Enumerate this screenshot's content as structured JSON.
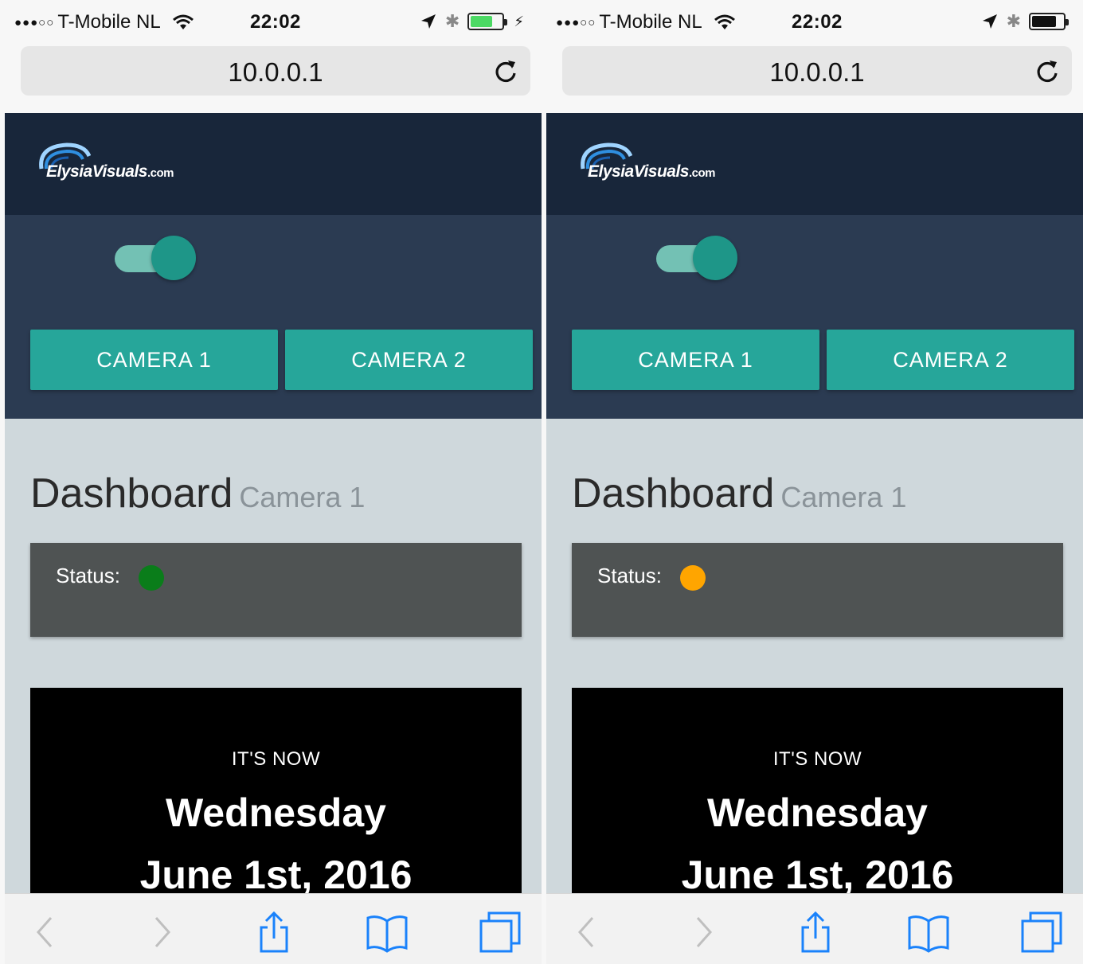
{
  "phones": [
    {
      "statusbar": {
        "signal": "●●●○○",
        "carrier": "T-Mobile NL",
        "time": "22:02",
        "bluetooth": "✱",
        "battery_fraction": 0.7,
        "battery_color": "#4cd964",
        "charging": true
      },
      "browser": {
        "url": "10.0.0.1"
      },
      "site": {
        "logo": {
          "text": "ElysiaVisuals",
          "suffix": ".com"
        },
        "toggle": {
          "state": "on"
        },
        "buttons": {
          "camera1": "CAMERA 1",
          "camera2": "CAMERA 2"
        },
        "dashboard": {
          "title": "Dashboard",
          "subtitle": "Camera 1"
        },
        "status": {
          "label": "Status:",
          "color": "#0a7d1a"
        },
        "clock": {
          "caption": "IT'S NOW",
          "day": "Wednesday",
          "date": "June 1st, 2016"
        }
      }
    },
    {
      "statusbar": {
        "signal": "●●●○○",
        "carrier": "T-Mobile NL",
        "time": "22:02",
        "bluetooth": "✱",
        "battery_fraction": 0.8,
        "battery_color": "#111111",
        "charging": false
      },
      "browser": {
        "url": "10.0.0.1"
      },
      "site": {
        "logo": {
          "text": "ElysiaVisuals",
          "suffix": ".com"
        },
        "toggle": {
          "state": "on"
        },
        "buttons": {
          "camera1": "CAMERA 1",
          "camera2": "CAMERA 2"
        },
        "dashboard": {
          "title": "Dashboard",
          "subtitle": "Camera 1"
        },
        "status": {
          "label": "Status:",
          "color": "#ffa500"
        },
        "clock": {
          "caption": "IT'S NOW",
          "day": "Wednesday",
          "date": "June 1st, 2016"
        }
      }
    }
  ],
  "theme": {
    "header": "#18263a",
    "panel": "#2b3b52",
    "accent": "#26a69a",
    "page_bg": "#cfd8dc",
    "ios_blue": "#1a82fb"
  },
  "icons": {
    "reload": "reload-icon",
    "back": "back-icon",
    "forward": "forward-icon",
    "share": "share-icon",
    "bookmarks": "bookmarks-icon",
    "tabs": "tabs-icon"
  }
}
